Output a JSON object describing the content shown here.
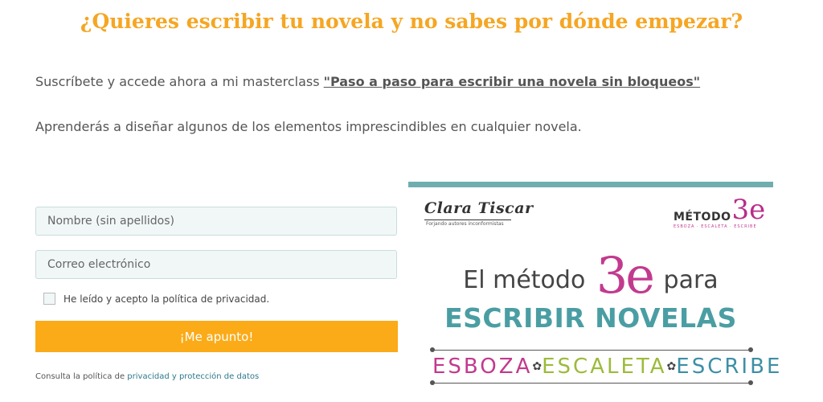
{
  "headline": "¿Quieres escribir tu novela y no sabes por dónde empezar?",
  "intro": {
    "text": "Suscríbete y accede ahora a mi masterclass ",
    "link": "\"Paso a paso para escribir una novela sin  bloqueos\""
  },
  "intro2": "Aprenderás a diseñar algunos de los elementos imprescindibles en cualquier novela.",
  "form": {
    "name_placeholder": "Nombre (sin apellidos)",
    "email_placeholder": "Correo electrónico",
    "consent_label": "He leído y acepto la política de privacidad.",
    "submit_label": "¡Me apunto!",
    "policy_text": "Consulta la política de ",
    "policy_link": "privacidad y protección de datos"
  },
  "banner": {
    "brand": "Clara Tiscar",
    "brand_tagline": "Forjando autores inconformistas",
    "method_word": "MÉTODO",
    "method_mark": "3e",
    "method_sub": "ESBOZA · ESCALETA · ESCRIBE",
    "title_pre": "El método",
    "title_mark": "3e",
    "title_post": "para",
    "subtitle": "ESCRIBIR NOVELAS",
    "steps": [
      "ESBOZA",
      "ESCALETA",
      "ESCRIBE"
    ],
    "colors": {
      "bar": "#6fadb0",
      "step1": "#c23a8e",
      "step2": "#9cbb3a",
      "step3": "#3d8fa6"
    }
  },
  "colors": {
    "accent": "#f5a623",
    "button": "#fbab18"
  }
}
